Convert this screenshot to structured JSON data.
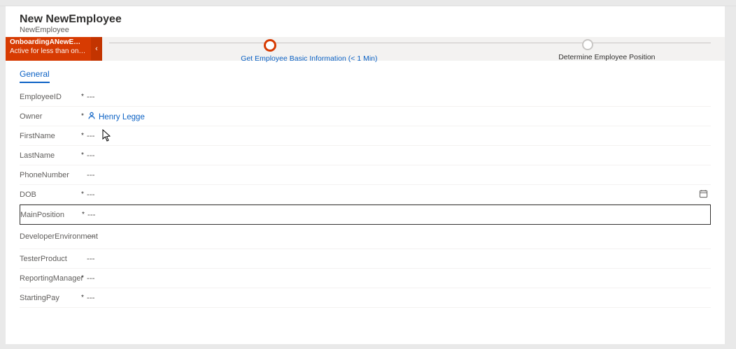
{
  "header": {
    "title": "New NewEmployee",
    "subtitle": "NewEmployee"
  },
  "process": {
    "chip_line1": "OnboardingANewEmplo…",
    "chip_line2": "Active for less than one mi…",
    "chip_chevron": "‹",
    "stage_current": "Get Employee Basic Information  (< 1 Min)",
    "stage_next": "Determine Employee Position"
  },
  "tabs": {
    "general": "General"
  },
  "placeholders": {
    "empty": "---"
  },
  "fields": {
    "employeeId": {
      "label": "EmployeeID",
      "required": "*",
      "value": "---"
    },
    "owner": {
      "label": "Owner",
      "required": "*",
      "value": "Henry Legge"
    },
    "firstName": {
      "label": "FirstName",
      "required": "*",
      "value": "---"
    },
    "lastName": {
      "label": "LastName",
      "required": "*",
      "value": "---"
    },
    "phoneNumber": {
      "label": "PhoneNumber",
      "required": "",
      "value": "---"
    },
    "dob": {
      "label": "DOB",
      "required": "*",
      "value": "---"
    },
    "mainPosition": {
      "label": "MainPosition",
      "required": "*",
      "value": "---"
    },
    "devEnvironment": {
      "label": "DeveloperEnvironment",
      "required": "",
      "value": "---"
    },
    "testerProduct": {
      "label": "TesterProduct",
      "required": "",
      "value": "---"
    },
    "reportingManager": {
      "label": "ReportingManager",
      "required": "*",
      "value": "---"
    },
    "startingPay": {
      "label": "StartingPay",
      "required": "*",
      "value": "---"
    }
  }
}
